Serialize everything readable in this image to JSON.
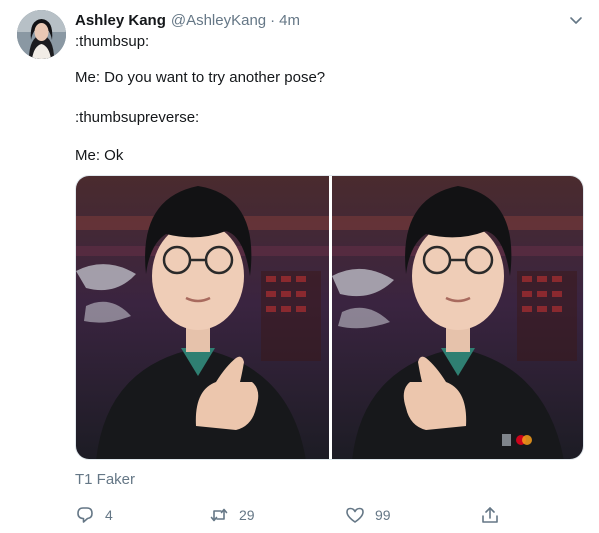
{
  "tweet": {
    "display_name": "Ashley Kang",
    "handle": "@AshleyKang",
    "separator": "·",
    "timestamp": "4m",
    "lines": [
      ":thumbsup:",
      "Me: Do you want to try another pose?",
      ":thumbsupreverse:",
      "Me: Ok"
    ],
    "media_caption": "T1 Faker",
    "actions": {
      "reply_count": "4",
      "retweet_count": "29",
      "like_count": "99"
    },
    "icons": {
      "avatar": "avatar-photo",
      "menu": "chevron-down-icon",
      "reply": "reply-icon",
      "retweet": "retweet-icon",
      "like": "heart-icon",
      "share": "share-icon"
    },
    "colors": {
      "text": "#14171a",
      "secondary": "#657786",
      "border": "#e1e8ed"
    }
  }
}
